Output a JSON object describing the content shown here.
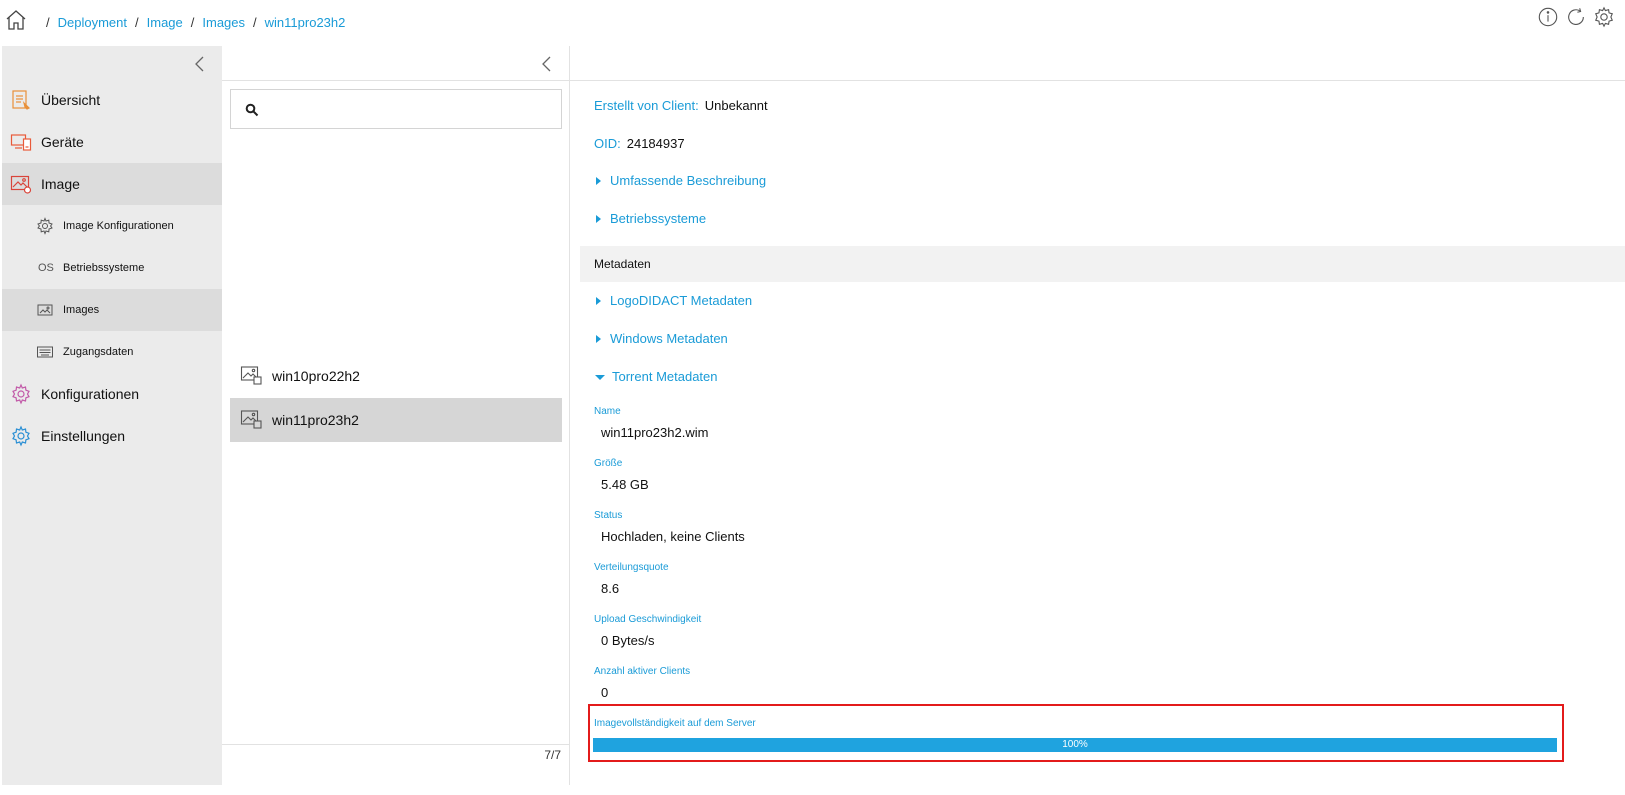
{
  "breadcrumb": {
    "items": [
      "Deployment",
      "Image",
      "Images",
      "win11pro23h2"
    ],
    "separator": "/"
  },
  "top_icons": [
    "info-icon",
    "refresh-icon",
    "settings-gear-icon"
  ],
  "sidebar": {
    "items": [
      {
        "label": "Übersicht",
        "icon": "overview-document-icon"
      },
      {
        "label": "Geräte",
        "icon": "devices-icon"
      },
      {
        "label": "Image",
        "icon": "image-icon",
        "active": true
      },
      {
        "label": "Image Konfigurationen",
        "icon": "image-config-gear-icon",
        "sub": true
      },
      {
        "label": "Betriebssysteme",
        "icon": "os-text-icon",
        "icon_text": "OS",
        "sub": true
      },
      {
        "label": "Images",
        "icon": "images-icon",
        "sub": true,
        "active": true
      },
      {
        "label": "Zugangsdaten",
        "icon": "credentials-keyboard-icon",
        "sub": true
      },
      {
        "label": "Konfigurationen",
        "icon": "configurations-gear-icon"
      },
      {
        "label": "Einstellungen",
        "icon": "settings-gear-icon"
      }
    ]
  },
  "list": {
    "search_value": "",
    "items": [
      {
        "label": "win10pro22h2",
        "selected": false
      },
      {
        "label": "win11pro23h2",
        "selected": true
      }
    ],
    "count": "7/7"
  },
  "detail": {
    "created_by_label": "Erstellt von Client:",
    "created_by_value": "Unbekannt",
    "oid_label": "OID:",
    "oid_value": "24184937",
    "sections": [
      "Umfassende Beschreibung",
      "Betriebssysteme"
    ],
    "metadata_header": "Metadaten",
    "meta_sections": [
      "LogoDIDACT Metadaten",
      "Windows Metadaten"
    ],
    "torrent_section": "Torrent Metadaten",
    "fields": [
      {
        "label": "Name",
        "value": "win11pro23h2.wim"
      },
      {
        "label": "Größe",
        "value": "5.48 GB"
      },
      {
        "label": "Status",
        "value": "Hochladen, keine Clients"
      },
      {
        "label": "Verteilungsquote",
        "value": "8.6"
      },
      {
        "label": "Upload Geschwindigkeit",
        "value": "0 Bytes/s"
      },
      {
        "label": "Anzahl aktiver Clients",
        "value": "0"
      }
    ],
    "completeness_label": "Imagevollständigkeit auf dem Server",
    "completeness_percent": 100,
    "completeness_text": "100%"
  },
  "colors": {
    "accent": "#1a9bd7",
    "progress": "#1fa3df",
    "highlight": "#e31b1b",
    "sidebar_bg": "#ebebeb"
  }
}
